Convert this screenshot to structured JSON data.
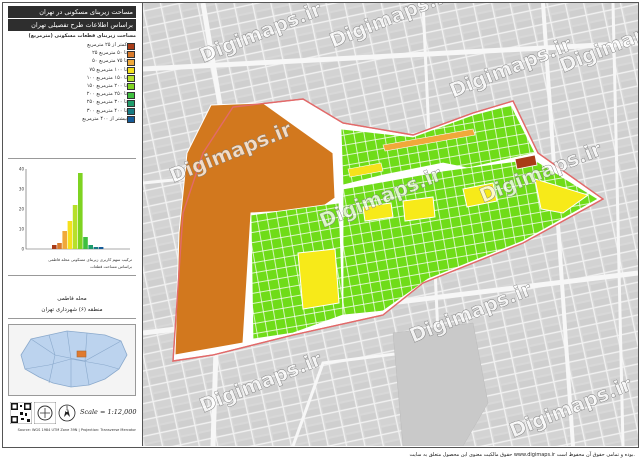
{
  "sidebar": {
    "title_line1": "مساحت زیربنای مسکونی در تهران",
    "title_line2": "براساس اطلاعات طرح تفصیلی تهران",
    "legend_heading": "مساحت زیربنای قطعات مسکونی (مترمربع)",
    "legend": [
      {
        "label": "کمتر از ۲۵ مترمربع",
        "color": "#a93b17"
      },
      {
        "label": "۲۵ تا ۵۰ مترمربع",
        "color": "#d97a2b"
      },
      {
        "label": "۵۰ تا ۷۵ مترمربع",
        "color": "#f0a93a"
      },
      {
        "label": "۷۵ تا ۱۰۰ مترمربع",
        "color": "#f6e11c"
      },
      {
        "label": "۱۰۰ تا ۱۵۰ مترمربع",
        "color": "#b7e02a"
      },
      {
        "label": "۱۵۰ تا ۲۰۰ مترمربع",
        "color": "#7ed321"
      },
      {
        "label": "۲۰۰ تا ۲۵۰ مترمربع",
        "color": "#3fbf3f"
      },
      {
        "label": "۲۵۰ تا ۳۰۰ مترمربع",
        "color": "#1f9c6b"
      },
      {
        "label": "۳۰۰ تا ۴۰۰ مترمربع",
        "color": "#187b84"
      },
      {
        "label": "بیشتر از ۴۰۰ مترمربع",
        "color": "#155b99"
      }
    ],
    "histogram_caption_1": "ترکیب سهم کاربری زیربنای مسکونی محله فاطمی",
    "histogram_caption_2": "براساس مساحت قطعات",
    "place_name": "محله فاطمی",
    "place_district": "منطقه (۶) شهرداری تهران",
    "scale": "Scale = 1:12,000",
    "north": "N",
    "credit": "Source: WGS 1984 UTM Zone 39N | Projection: Transverse Mercator"
  },
  "map": {
    "watermarks": [
      "Digimaps.ir",
      "Digimaps.ir",
      "Digimaps.ir",
      "Digimaps.ir",
      "Digimaps.ir",
      "Digimaps.ir",
      "Digimaps.ir",
      "Digimaps.ir",
      "Digimaps.ir",
      "Digimaps.ir"
    ]
  },
  "footer": "حقوق مالکیت معنوی این محصول متعلق به سایت www.digimaps.ir بوده و تمامی حقوق آن محفوظ است.",
  "chart_data": {
    "type": "bar",
    "categories": [
      "1",
      "2",
      "3",
      "4",
      "5",
      "6",
      "7",
      "8",
      "9",
      "10"
    ],
    "values": [
      2,
      3,
      9,
      14,
      22,
      38,
      6,
      2,
      1,
      1
    ],
    "colors": [
      "#a93b17",
      "#d97a2b",
      "#f0a93a",
      "#f6e11c",
      "#b7e02a",
      "#7ed321",
      "#3fbf3f",
      "#1f9c6b",
      "#187b84",
      "#155b99"
    ],
    "ylim": [
      0,
      40
    ],
    "yticks": [
      "0",
      "10",
      "20",
      "30",
      "40"
    ]
  }
}
